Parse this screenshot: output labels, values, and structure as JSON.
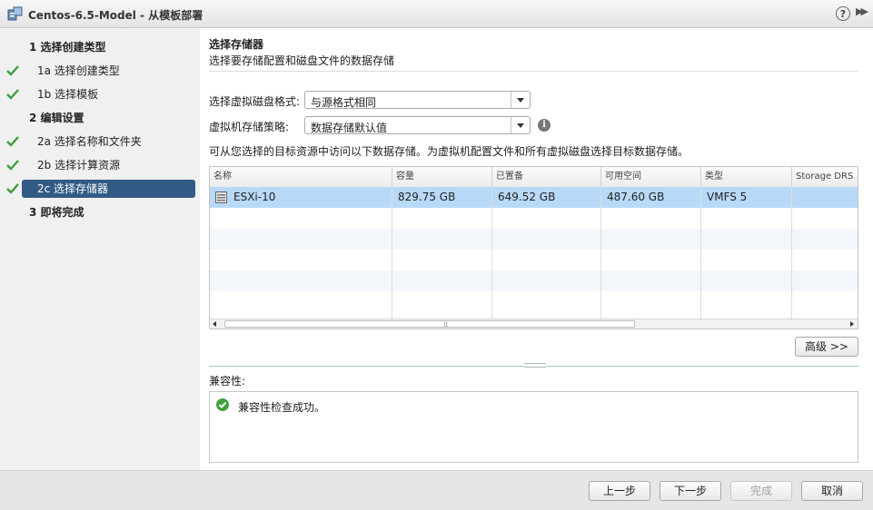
{
  "window": {
    "title": "Centos-6.5-Model - 从模板部署"
  },
  "nav": {
    "items": [
      {
        "label": "1  选择创建类型",
        "kind": "header",
        "checked": false,
        "active": false
      },
      {
        "label": "1a 选择创建类型",
        "kind": "sub",
        "checked": true,
        "active": false
      },
      {
        "label": "1b 选择模板",
        "kind": "sub",
        "checked": true,
        "active": false
      },
      {
        "label": "2  编辑设置",
        "kind": "header",
        "checked": false,
        "active": false
      },
      {
        "label": "2a 选择名称和文件夹",
        "kind": "sub",
        "checked": true,
        "active": false
      },
      {
        "label": "2b 选择计算资源",
        "kind": "sub",
        "checked": true,
        "active": false
      },
      {
        "label": "2c 选择存储器",
        "kind": "sub",
        "checked": true,
        "active": true
      },
      {
        "label": "3  即将完成",
        "kind": "header",
        "checked": false,
        "active": false
      }
    ]
  },
  "main": {
    "title": "选择存储器",
    "subtitle": "选择要存储配置和磁盘文件的数据存储",
    "disk_format": {
      "label": "选择虚拟磁盘格式:",
      "value": "与源格式相同"
    },
    "storage_policy": {
      "label": "虚拟机存储策略:",
      "value": "数据存储默认值"
    },
    "description": "可从您选择的目标资源中访问以下数据存储。为虚拟机配置文件和所有虚拟磁盘选择目标数据存储。",
    "table": {
      "columns": [
        "名称",
        "容量",
        "已置备",
        "可用空间",
        "类型",
        "Storage DRS"
      ],
      "rows": [
        {
          "name": "ESXi-10",
          "capacity": "829.75 GB",
          "provisioned": "649.52 GB",
          "free": "487.60 GB",
          "type": "VMFS 5",
          "sdrs": ""
        }
      ]
    },
    "advanced_button": "高级 >>",
    "compat_label": "兼容性:",
    "compat_message": "兼容性检查成功。"
  },
  "footer": {
    "back": "上一步",
    "next": "下一步",
    "finish": "完成",
    "cancel": "取消"
  },
  "colors": {
    "accent": "#315b85",
    "selected_row": "#b8d9f8",
    "check": "#3c9e3c"
  }
}
